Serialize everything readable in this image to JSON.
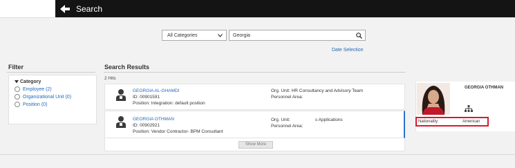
{
  "header": {
    "title": "Search"
  },
  "search": {
    "category": "All Categories",
    "query": "Georgia",
    "date_selection": "Date Selection"
  },
  "filter": {
    "title": "Filter",
    "category_label": "Category",
    "options": [
      {
        "label": "Employee (2)"
      },
      {
        "label": "Organizational Unit (0)"
      },
      {
        "label": "Position (0)"
      }
    ]
  },
  "results": {
    "title": "Search Results",
    "hits": "2 Hits",
    "items": [
      {
        "name": "GEORGIA AL-GHAMDI",
        "id": "ID: 00901591",
        "position": "Position: Integration: default position",
        "org_unit": "Org. Unit: HR Consultancy and Advisory Team",
        "personnel_area": "Personnel Area:"
      },
      {
        "name": "GEORGIA OTHMAN",
        "id": "ID: 00902921",
        "position": "Position: Vendor Contractor- BPM Consultant",
        "org_unit": "Org. Unit:                    s Applications",
        "personnel_area": "Personnel Area:"
      }
    ],
    "show_more": "Show More"
  },
  "profile": {
    "name": "GEORGIA OTHMAN",
    "nationality_label": "Nationality:",
    "nationality_value": "American"
  },
  "colors": {
    "header_bg": "#141414",
    "link": "#2068b8",
    "highlight": "#d7192b",
    "selected": "#2b73c9"
  },
  "icons": [
    "back-arrow-icon",
    "chevron-down-icon",
    "search-icon",
    "caret-down-icon",
    "radio-icon",
    "person-icon",
    "org-chart-icon"
  ]
}
